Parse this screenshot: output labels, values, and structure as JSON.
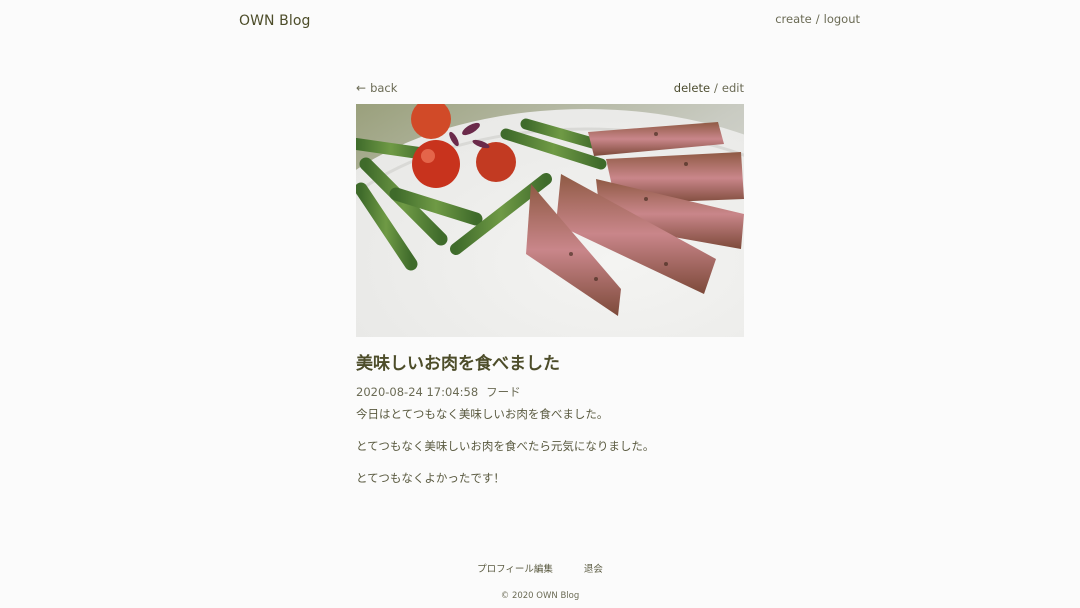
{
  "header": {
    "logo": "OWN Blog",
    "create_label": "create",
    "separator": "/",
    "logout_label": "logout"
  },
  "actions": {
    "back_arrow": "←",
    "back_label": "back",
    "delete_label": "delete",
    "separator": "/",
    "edit_label": "edit"
  },
  "post": {
    "image_icon": "steak-with-asparagus-photo",
    "title": "美味しいお肉を食べました",
    "datetime": "2020-08-24 17:04:58",
    "category": "フード",
    "paragraphs": [
      "今日はとてつもなく美味しいお肉を食べました。",
      "とてつもなく美味しいお肉を食べたら元気になりました。",
      "とてつもなくよかったです！"
    ]
  },
  "footer": {
    "profile_edit_label": "プロフィール編集",
    "withdraw_label": "退会",
    "copyright": "© 2020 OWN Blog"
  },
  "colors": {
    "background": "#fbfbfb",
    "text": "#5a5a40",
    "heading": "#4d4d2a"
  }
}
